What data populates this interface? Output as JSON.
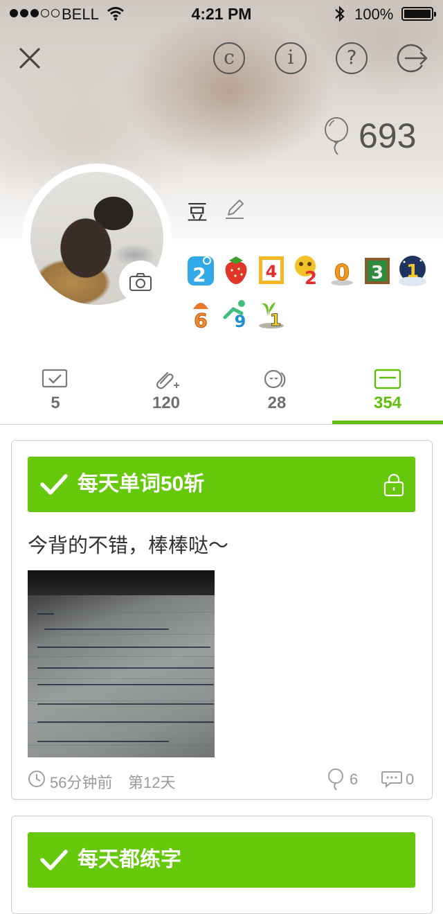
{
  "status_bar": {
    "carrier": "BELL",
    "time": "4:21 PM",
    "battery": "100%"
  },
  "header": {
    "likes_count": "693",
    "nickname": "豆",
    "icons": [
      "close-icon",
      "copyright-icon",
      "info-icon",
      "help-icon",
      "logout-icon",
      "balloon-icon",
      "edit-icon",
      "camera-icon"
    ]
  },
  "badges": [
    [
      "2",
      "strawberry",
      "4",
      "2",
      "0",
      "3",
      "1"
    ],
    [
      "6",
      "9",
      "1"
    ]
  ],
  "tabs": [
    {
      "icon": "checkbox-icon",
      "count": "5"
    },
    {
      "icon": "paperclip-icon",
      "count": "120"
    },
    {
      "icon": "faces-icon",
      "count": "28"
    },
    {
      "icon": "card-icon",
      "count": "354",
      "active": true
    }
  ],
  "posts": [
    {
      "goal": "每天单词50斩",
      "locked": true,
      "text": "今背的不错，棒棒哒～",
      "time_ago": "56分钟前",
      "day": "第12天",
      "likes": "6",
      "comments": "0"
    },
    {
      "goal": "每天都练字"
    }
  ],
  "colors": {
    "accent": "#66c80a",
    "active_tab": "#5fbe0a",
    "muted": "#9a9a9a"
  }
}
